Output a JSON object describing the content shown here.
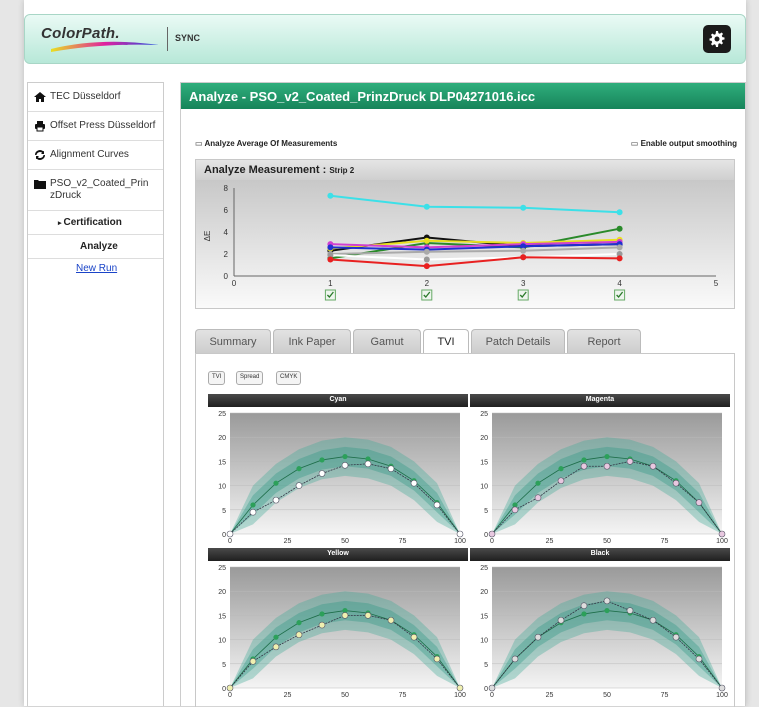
{
  "header": {
    "logo_text": "ColorPath.",
    "product": "SYNC"
  },
  "sidebar": {
    "location": "TEC Düsseldorf",
    "device": "Offset Press Düsseldorf",
    "alignment": "Alignment Curves",
    "profile": "PSO_v2_Coated_PrinzDruck",
    "certification": "Certification",
    "analyze": "Analyze",
    "new_run": "New Run"
  },
  "main": {
    "title": "Analyze - PSO_v2_Coated_PrinzDruck DLP04271016.icc",
    "option_average": "Analyze Average Of Measurements",
    "option_smoothing": "Enable output smoothing",
    "measurement_title": "Analyze Measurement :",
    "measurement_strip": "Strip 2"
  },
  "tabs": [
    "Summary",
    "Ink Paper",
    "Gamut",
    "TVI",
    "Patch Details",
    "Report"
  ],
  "active_tab": "TVI",
  "toggles": [
    "TVI",
    "Spread",
    "CMYK"
  ],
  "colors": {
    "accent": "#1f9a6a",
    "measured": "#2ca05a"
  },
  "chart_data": [
    {
      "type": "line",
      "title": "Analyze Measurement : Strip 2",
      "ylabel": "ΔE",
      "xlim": [
        0,
        5
      ],
      "ylim": [
        0,
        8
      ],
      "x_ticks": [
        0,
        1,
        2,
        3,
        4,
        5
      ],
      "y_ticks": [
        0,
        2,
        4,
        6,
        8
      ],
      "checked": [
        1,
        2,
        3,
        4
      ],
      "series": [
        {
          "color": "#3ce0e8",
          "x": [
            1,
            2,
            3,
            4
          ],
          "y": [
            7.3,
            6.3,
            6.2,
            5.8
          ]
        },
        {
          "color": "#2a8a2a",
          "x": [
            1,
            2,
            3,
            4
          ],
          "y": [
            1.6,
            3.0,
            2.6,
            4.3
          ]
        },
        {
          "color": "#111111",
          "x": [
            1,
            2,
            3,
            4
          ],
          "y": [
            2.3,
            3.5,
            2.7,
            2.9
          ]
        },
        {
          "color": "#e8e020",
          "x": [
            1,
            2,
            3,
            4
          ],
          "y": [
            2.5,
            3.2,
            3.0,
            3.3
          ]
        },
        {
          "color": "#d040d0",
          "x": [
            1,
            2,
            3,
            4
          ],
          "y": [
            2.9,
            2.6,
            2.9,
            3.1
          ]
        },
        {
          "color": "#2030d0",
          "x": [
            1,
            2,
            3,
            4
          ],
          "y": [
            2.6,
            2.4,
            2.7,
            2.9
          ]
        },
        {
          "color": "#aaaaaa",
          "x": [
            1,
            2,
            3,
            4
          ],
          "y": [
            2.0,
            2.2,
            2.3,
            2.6
          ]
        },
        {
          "color": "#ffffff",
          "x": [
            1,
            2,
            3,
            4
          ],
          "y": [
            1.9,
            1.5,
            1.7,
            2.0
          ]
        },
        {
          "color": "#e82020",
          "x": [
            1,
            2,
            3,
            4
          ],
          "y": [
            1.5,
            0.9,
            1.7,
            1.6
          ]
        }
      ]
    },
    {
      "type": "line",
      "title": "Cyan",
      "xlim": [
        0,
        100
      ],
      "ylim": [
        0,
        25
      ],
      "x": [
        0,
        10,
        20,
        30,
        40,
        50,
        60,
        70,
        80,
        90,
        100
      ],
      "series": [
        {
          "color": "#2ca05a",
          "y": [
            0,
            6,
            10.5,
            13.5,
            15.3,
            16,
            15.5,
            14,
            11,
            6.5,
            0
          ]
        },
        {
          "color": "#ffffff",
          "y": [
            0,
            4.5,
            7,
            10,
            12.5,
            14.2,
            14.5,
            13.5,
            10.5,
            6,
            0
          ]
        }
      ]
    },
    {
      "type": "line",
      "title": "Magenta",
      "xlim": [
        0,
        100
      ],
      "ylim": [
        0,
        25
      ],
      "x": [
        0,
        10,
        20,
        30,
        40,
        50,
        60,
        70,
        80,
        90,
        100
      ],
      "series": [
        {
          "color": "#2ca05a",
          "y": [
            0,
            6,
            10.5,
            13.5,
            15.3,
            16,
            15.5,
            14,
            11,
            6.5,
            0
          ]
        },
        {
          "color": "#e8c8e0",
          "y": [
            0,
            5,
            7.5,
            11,
            14,
            14,
            15,
            14,
            10.5,
            6.5,
            0
          ]
        }
      ]
    },
    {
      "type": "line",
      "title": "Yellow",
      "xlim": [
        0,
        100
      ],
      "ylim": [
        0,
        25
      ],
      "x": [
        0,
        10,
        20,
        30,
        40,
        50,
        60,
        70,
        80,
        90,
        100
      ],
      "series": [
        {
          "color": "#2ca05a",
          "y": [
            0,
            6,
            10.5,
            13.5,
            15.3,
            16,
            15.5,
            14,
            11,
            6.5,
            0
          ]
        },
        {
          "color": "#f0f0b0",
          "y": [
            0,
            5.5,
            8.5,
            11,
            13,
            15,
            15,
            14,
            10.5,
            6,
            0
          ]
        }
      ]
    },
    {
      "type": "line",
      "title": "Black",
      "xlim": [
        0,
        100
      ],
      "ylim": [
        0,
        25
      ],
      "x": [
        0,
        10,
        20,
        30,
        40,
        50,
        60,
        70,
        80,
        90,
        100
      ],
      "series": [
        {
          "color": "#2ca05a",
          "y": [
            0,
            6,
            10.5,
            13.5,
            15.3,
            16,
            15.5,
            14,
            11,
            6.5,
            0
          ]
        },
        {
          "color": "#dddddd",
          "y": [
            0,
            6,
            10.5,
            14,
            17,
            18,
            16,
            14,
            10.5,
            6,
            0
          ]
        }
      ]
    }
  ]
}
